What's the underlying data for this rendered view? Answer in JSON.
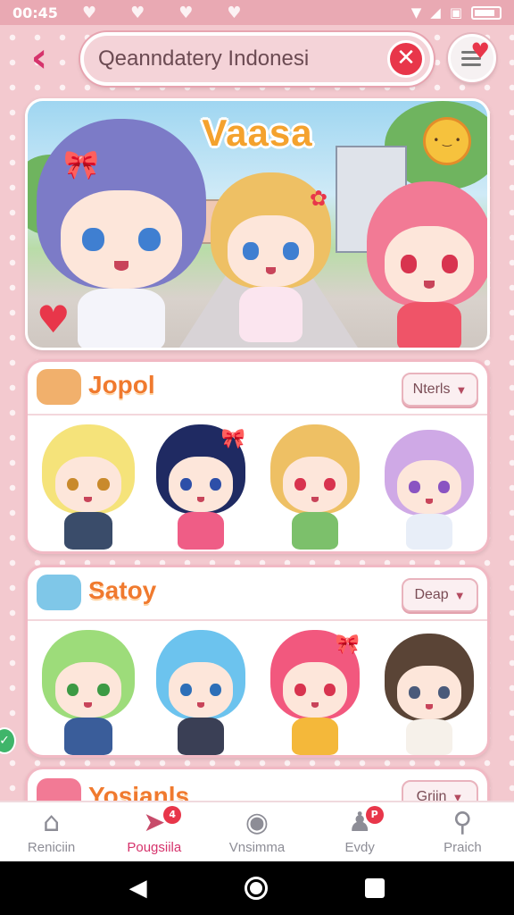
{
  "status": {
    "time": "00:45",
    "signal_icon": "signal-icon",
    "wifi_icon": "wifi-icon",
    "battery_icon": "battery-icon"
  },
  "header": {
    "back_icon": "chevron-left-icon",
    "search_value": "Qeanndatery Indonesi",
    "clear_icon": "close-icon",
    "favorites_icon": "list-heart-icon"
  },
  "banner": {
    "title": "Vaasa",
    "colors": {
      "title": "#f4a22e",
      "accent": "#e8364a"
    }
  },
  "categories": [
    {
      "title": "Jopol",
      "sort_label": "Nterls",
      "chevron": "⌄",
      "icon": "cat-icon"
    },
    {
      "title": "Satoy",
      "sort_label": "Deap",
      "chevron": "⌄",
      "icon": "toybox-icon"
    },
    {
      "title": "Yosianls",
      "sort_label": "Griin",
      "chevron": "⌄",
      "icon": "pink-hair-icon"
    }
  ],
  "nav": {
    "items": [
      {
        "label": "Reniciin",
        "icon": "home-icon"
      },
      {
        "label": "Pougsiila",
        "icon": "paper-plane-icon",
        "badge": "4"
      },
      {
        "label": "Vnsimma",
        "icon": "compass-icon"
      },
      {
        "label": "Evdy",
        "icon": "person-icon",
        "badge": "P"
      },
      {
        "label": "Praich",
        "icon": "search-icon"
      }
    ]
  },
  "colors": {
    "accent": "#d6336c",
    "background": "#f3c9cf",
    "card_border": "#f1b9c4"
  }
}
